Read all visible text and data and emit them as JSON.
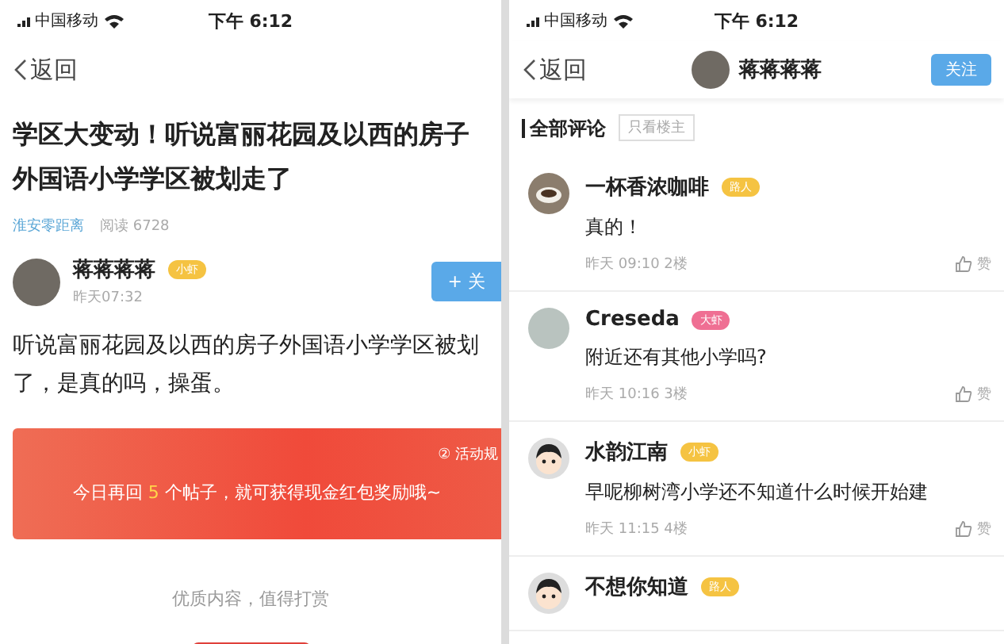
{
  "left": {
    "status_bar": {
      "carrier": "中国移动",
      "time": "下午 6:12"
    },
    "nav": {
      "back": "返回"
    },
    "title_lines": [
      "学区大变动！听说富丽花园及以西的房子",
      "外国语小学学区被划走了"
    ],
    "meta": {
      "source": "淮安零距离",
      "reads": "阅读 6728"
    },
    "author": {
      "name": "蒋蒋蒋蒋",
      "badge": "小虾",
      "time": "昨天07:32",
      "follow": "+ 关"
    },
    "body_lines": [
      "听说富丽花园及以西的房子外国语小学学区被划",
      "了，是真的吗，操蛋。"
    ],
    "banner": {
      "rules": "② 活动规",
      "text_before": "今日再回",
      "count": "5",
      "text_after": "个帖子，就可获得现金红包奖励哦~"
    },
    "reward": {
      "caption": "优质内容，值得打赏"
    }
  },
  "right": {
    "status_bar": {
      "carrier": "中国移动",
      "time": "下午 6:12"
    },
    "nav": {
      "back": "返回",
      "user": "蒋蒋蒋蒋",
      "follow": "关注"
    },
    "filter": {
      "all": "全部评论",
      "op_only": "只看楼主"
    },
    "comments": [
      {
        "name": "一杯香浓咖啡",
        "badge": "路人",
        "color": "#f5c342",
        "kind": "cup",
        "text": "真的！",
        "meta": "昨天 09:10  2楼",
        "like": "赞"
      },
      {
        "name": "Creseda",
        "badge": "大虾",
        "color": "#ef6f93",
        "kind": "photo",
        "text": "附近还有其他小学吗?",
        "meta": "昨天 10:16  3楼",
        "like": "赞"
      },
      {
        "name": "水韵江南",
        "badge": "小虾",
        "color": "#f5c342",
        "kind": "cartoon",
        "text": "早呢柳树湾小学还不知道什么时候开始建",
        "meta": "昨天 11:15  4楼",
        "like": "赞"
      },
      {
        "name": "不想你知道",
        "badge": "路人",
        "color": "#f5c342",
        "kind": "cartoon"
      }
    ]
  }
}
